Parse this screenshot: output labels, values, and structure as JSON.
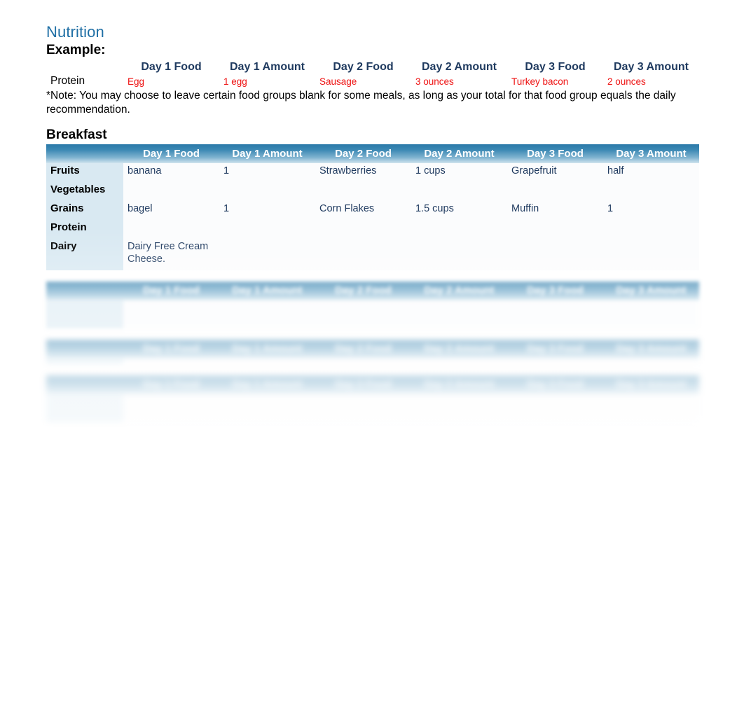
{
  "document": {
    "title": "Nutrition",
    "note": "*Note: You may choose to leave certain food groups blank for some meals, as long as your total for that food group equals the daily recommendation."
  },
  "columns": {
    "row_label": "",
    "headers": [
      "Day 1 Food",
      "Day 1 Amount",
      "Day 2 Food",
      "Day 2 Amount",
      "Day 3 Food",
      "Day 3 Amount"
    ]
  },
  "example": {
    "heading": "Example:",
    "row": {
      "label": "Protein",
      "day1_food": "Egg",
      "day1_amount": "1 egg",
      "day2_food": "Sausage",
      "day2_amount": "3 ounces",
      "day3_food": "Turkey bacon",
      "day3_amount": "2 ounces"
    }
  },
  "sections": [
    {
      "heading": "Breakfast",
      "blur": "none",
      "rows": [
        {
          "label": "Fruits",
          "day1_food": "banana",
          "day1_amount": "1",
          "day2_food": "Strawberries",
          "day2_amount": "1 cups",
          "day3_food": "Grapefruit",
          "day3_amount": "half"
        },
        {
          "label": "Vegetables",
          "day1_food": "",
          "day1_amount": "",
          "day2_food": "",
          "day2_amount": "",
          "day3_food": "",
          "day3_amount": ""
        },
        {
          "label": "Grains",
          "day1_food": "bagel",
          "day1_amount": "1",
          "day2_food": "Corn Flakes",
          "day2_amount": "1.5 cups",
          "day3_food": "Muffin",
          "day3_amount": "1"
        },
        {
          "label": "Protein",
          "day1_food": "",
          "day1_amount": "",
          "day2_food": "",
          "day2_amount": "",
          "day3_food": "",
          "day3_amount": ""
        },
        {
          "label": "Dairy",
          "day1_food": "Dairy Free Cream Cheese.",
          "day1_amount": "",
          "day2_food": "",
          "day2_amount": "",
          "day3_food": "",
          "day3_amount": ""
        }
      ]
    },
    {
      "heading": "",
      "blur": "blur-2",
      "rows": [
        {
          "label": "",
          "day1_food": "",
          "day1_amount": "",
          "day2_food": "",
          "day2_amount": "",
          "day3_food": "",
          "day3_amount": ""
        },
        {
          "label": "",
          "day1_food": "",
          "day1_amount": "",
          "day2_food": "",
          "day2_amount": "",
          "day3_food": "",
          "day3_amount": ""
        },
        {
          "label": "",
          "day1_food": "",
          "day1_amount": "",
          "day2_food": "",
          "day2_amount": "",
          "day3_food": "",
          "day3_amount": ""
        },
        {
          "label": "",
          "day1_food": "",
          "day1_amount": "",
          "day2_food": "",
          "day2_amount": "",
          "day3_food": "",
          "day3_amount": ""
        },
        {
          "label": "",
          "day1_food": "",
          "day1_amount": "",
          "day2_food": "",
          "day2_amount": "",
          "day3_food": "",
          "day3_amount": ""
        }
      ]
    },
    {
      "heading": "",
      "blur": "blur-3",
      "rows": [
        {
          "label": "",
          "day1_food": "",
          "day1_amount": "",
          "day2_food": "",
          "day2_amount": "",
          "day3_food": "",
          "day3_amount": ""
        }
      ]
    },
    {
      "heading": "",
      "blur": "blur-4",
      "rows": [
        {
          "label": "",
          "day1_food": "",
          "day1_amount": "",
          "day2_food": "",
          "day2_amount": "",
          "day3_food": "",
          "day3_amount": ""
        },
        {
          "label": "",
          "day1_food": "",
          "day1_amount": "",
          "day2_food": "",
          "day2_amount": "",
          "day3_food": "",
          "day3_amount": ""
        },
        {
          "label": "",
          "day1_food": "",
          "day1_amount": "",
          "day2_food": "",
          "day2_amount": "",
          "day3_food": "",
          "day3_amount": ""
        },
        {
          "label": "",
          "day1_food": "",
          "day1_amount": "",
          "day2_food": "",
          "day2_amount": "",
          "day3_food": "",
          "day3_amount": ""
        },
        {
          "label": "",
          "day1_food": "",
          "day1_amount": "",
          "day2_food": "",
          "day2_amount": "",
          "day3_food": "",
          "day3_amount": ""
        }
      ]
    }
  ],
  "colors": {
    "title": "#1f6fa5",
    "header_bar_top": "#2b7aa9",
    "header_bar_bottom": "#cfe3ee",
    "row_label_bg": "#d9e9f2",
    "cell_text": "#1f3a5f",
    "example_value": "#ee1111",
    "page_bg": "#ffffff"
  }
}
